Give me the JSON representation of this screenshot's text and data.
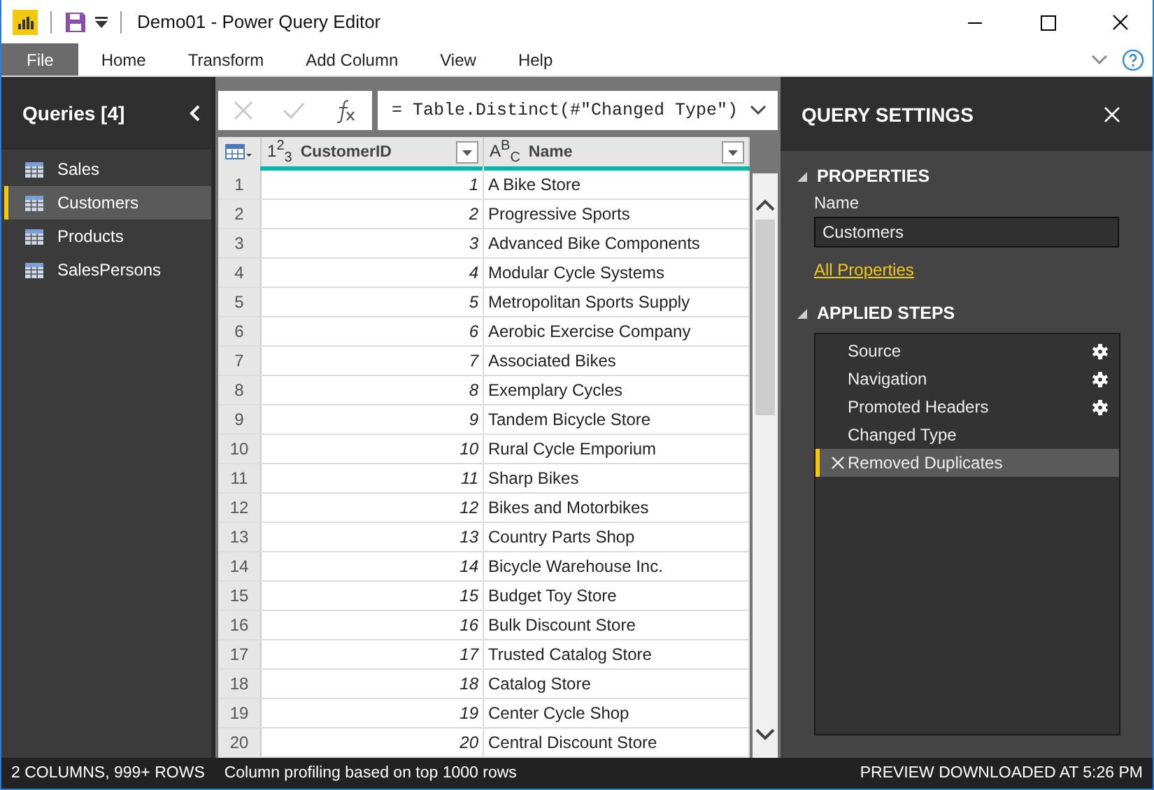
{
  "window": {
    "title": "Demo01 - Power Query Editor"
  },
  "menu_tabs": [
    {
      "label": "File",
      "selected": true
    },
    {
      "label": "Home",
      "selected": false
    },
    {
      "label": "Transform",
      "selected": false
    },
    {
      "label": "Add Column",
      "selected": false
    },
    {
      "label": "View",
      "selected": false
    },
    {
      "label": "Help",
      "selected": false
    }
  ],
  "queries": {
    "title": "Queries [4]",
    "items": [
      {
        "label": "Sales",
        "selected": false
      },
      {
        "label": "Customers",
        "selected": true
      },
      {
        "label": "Products",
        "selected": false
      },
      {
        "label": "SalesPersons",
        "selected": false
      }
    ]
  },
  "formula_bar": {
    "formula": "= Table.Distinct(#\"Changed Type\")"
  },
  "table": {
    "columns": [
      {
        "label": "CustomerID",
        "type_icon": "1$^{2}$$_{3}$",
        "kind": "number"
      },
      {
        "label": "Name",
        "type_icon": "A$^{B}$$_{C}$",
        "kind": "text"
      }
    ],
    "rows": [
      {
        "row_number": "1",
        "customer_id": "1",
        "name": "A Bike Store"
      },
      {
        "row_number": "2",
        "customer_id": "2",
        "name": "Progressive Sports"
      },
      {
        "row_number": "3",
        "customer_id": "3",
        "name": "Advanced Bike Components"
      },
      {
        "row_number": "4",
        "customer_id": "4",
        "name": "Modular Cycle Systems"
      },
      {
        "row_number": "5",
        "customer_id": "5",
        "name": "Metropolitan Sports Supply"
      },
      {
        "row_number": "6",
        "customer_id": "6",
        "name": "Aerobic Exercise Company"
      },
      {
        "row_number": "7",
        "customer_id": "7",
        "name": "Associated Bikes"
      },
      {
        "row_number": "8",
        "customer_id": "8",
        "name": "Exemplary Cycles"
      },
      {
        "row_number": "9",
        "customer_id": "9",
        "name": "Tandem Bicycle Store"
      },
      {
        "row_number": "10",
        "customer_id": "10",
        "name": "Rural Cycle Emporium"
      },
      {
        "row_number": "11",
        "customer_id": "11",
        "name": "Sharp Bikes"
      },
      {
        "row_number": "12",
        "customer_id": "12",
        "name": "Bikes and Motorbikes"
      },
      {
        "row_number": "13",
        "customer_id": "13",
        "name": "Country Parts Shop"
      },
      {
        "row_number": "14",
        "customer_id": "14",
        "name": "Bicycle Warehouse Inc."
      },
      {
        "row_number": "15",
        "customer_id": "15",
        "name": "Budget Toy Store"
      },
      {
        "row_number": "16",
        "customer_id": "16",
        "name": "Bulk Discount Store"
      },
      {
        "row_number": "17",
        "customer_id": "17",
        "name": "Trusted Catalog Store"
      },
      {
        "row_number": "18",
        "customer_id": "18",
        "name": "Catalog Store"
      },
      {
        "row_number": "19",
        "customer_id": "19",
        "name": "Center Cycle Shop"
      },
      {
        "row_number": "20",
        "customer_id": "20",
        "name": "Central Discount Store"
      }
    ]
  },
  "query_settings": {
    "title": "QUERY SETTINGS",
    "properties_heading": "PROPERTIES",
    "name_label": "Name",
    "name_value": "Customers",
    "all_properties_link": "All Properties",
    "applied_steps_heading": "APPLIED STEPS",
    "steps": [
      {
        "label": "Source",
        "has_settings": true,
        "selected": false
      },
      {
        "label": "Navigation",
        "has_settings": true,
        "selected": false
      },
      {
        "label": "Promoted Headers",
        "has_settings": true,
        "selected": false
      },
      {
        "label": "Changed Type",
        "has_settings": false,
        "selected": false
      },
      {
        "label": "Removed Duplicates",
        "has_settings": false,
        "selected": true
      }
    ]
  },
  "status_bar": {
    "columns_rows": "2 COLUMNS, 999+ ROWS",
    "profiling": "Column profiling based on top 1000 rows",
    "preview": "PREVIEW DOWNLOADED AT 5:26 PM"
  }
}
